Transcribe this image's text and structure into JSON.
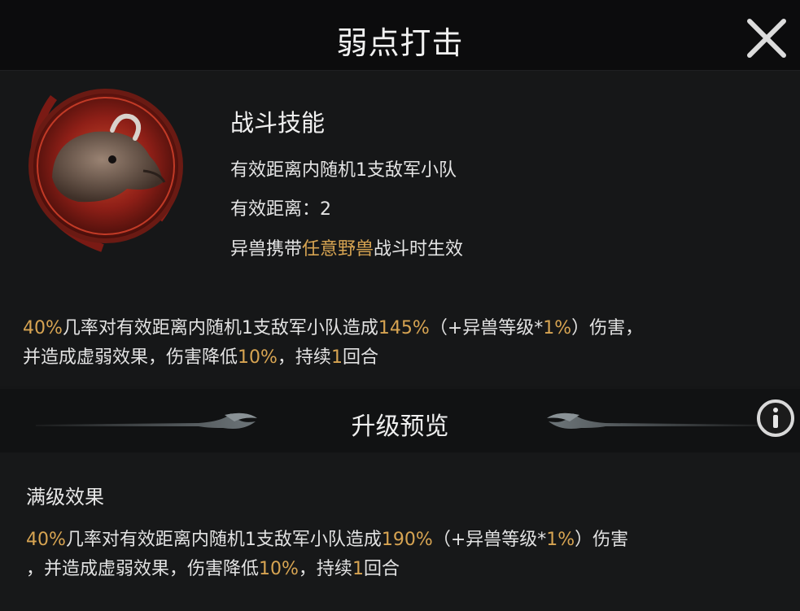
{
  "header": {
    "title": "弱点打击"
  },
  "skill": {
    "type": "战斗技能",
    "target": "有效距离内随机1支敌军小队",
    "range": "有效距离：2",
    "condition_prefix": "异兽携带",
    "condition_highlight": "任意野兽",
    "condition_suffix": "战斗时生效"
  },
  "effect": {
    "p1": "40%",
    "t1": "几率对有效距离内随机1支敌军小队造成",
    "p2": "145%",
    "t2": "（+异兽等级*",
    "p3": "1%",
    "t3": "）伤害，",
    "t4": "并造成虚弱效果，伤害降低",
    "p4": "10%",
    "t5": "，持续",
    "p5": "1",
    "t6": "回合"
  },
  "upgrade": {
    "title": "升级预览",
    "max_label": "满级效果",
    "p1": "40%",
    "t1": "几率对有效距离内随机1支敌军小队造成",
    "p2": "190%",
    "t2": "（+异兽等级*",
    "p3": "1%",
    "t3": "）伤害",
    "t4": "，并造成虚弱效果，伤害降低",
    "p4": "10%",
    "t5": "，持续",
    "p5": "1",
    "t6": "回合"
  },
  "colors": {
    "highlight": "#d7a452",
    "icon_ring": "#b0271f"
  },
  "icons": {
    "close": "close-icon",
    "info": "info-icon",
    "skill": "boar-skill-icon"
  }
}
